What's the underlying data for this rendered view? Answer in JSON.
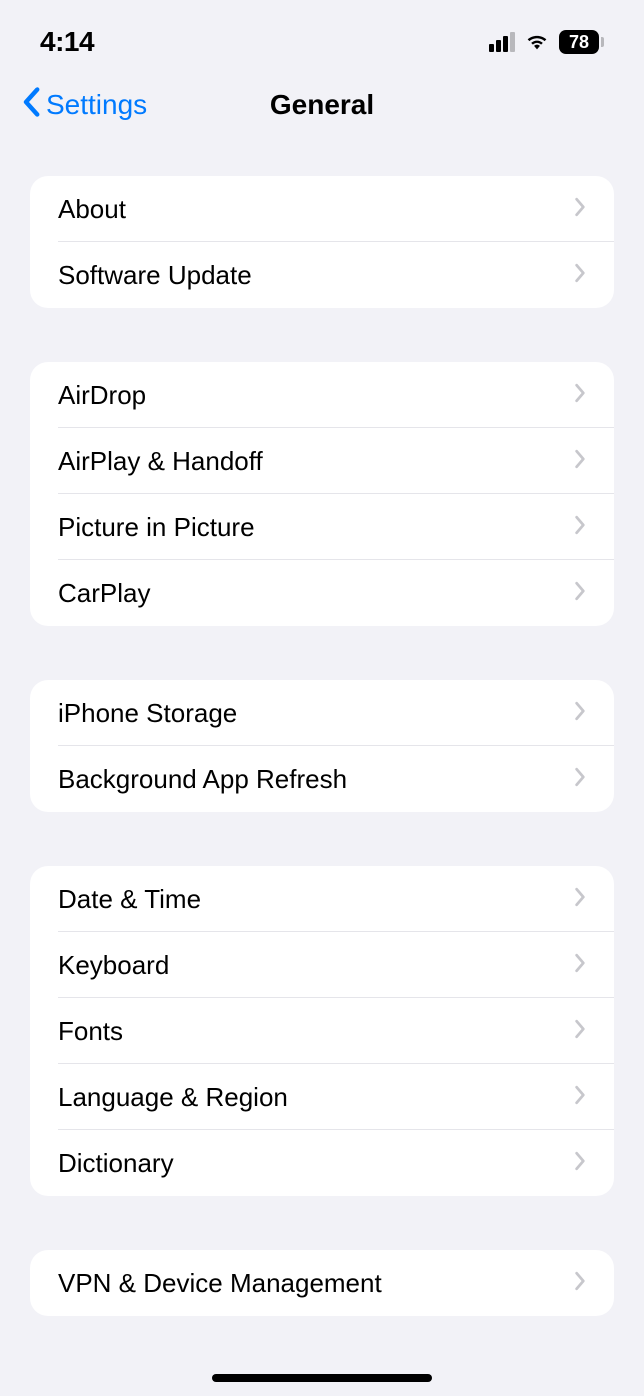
{
  "status": {
    "time": "4:14",
    "battery": "78"
  },
  "nav": {
    "back_label": "Settings",
    "title": "General"
  },
  "sections": [
    {
      "items": [
        {
          "label": "About"
        },
        {
          "label": "Software Update"
        }
      ]
    },
    {
      "items": [
        {
          "label": "AirDrop"
        },
        {
          "label": "AirPlay & Handoff"
        },
        {
          "label": "Picture in Picture"
        },
        {
          "label": "CarPlay"
        }
      ]
    },
    {
      "items": [
        {
          "label": "iPhone Storage"
        },
        {
          "label": "Background App Refresh"
        }
      ]
    },
    {
      "items": [
        {
          "label": "Date & Time"
        },
        {
          "label": "Keyboard"
        },
        {
          "label": "Fonts"
        },
        {
          "label": "Language & Region"
        },
        {
          "label": "Dictionary"
        }
      ]
    },
    {
      "items": [
        {
          "label": "VPN & Device Management"
        }
      ]
    }
  ]
}
